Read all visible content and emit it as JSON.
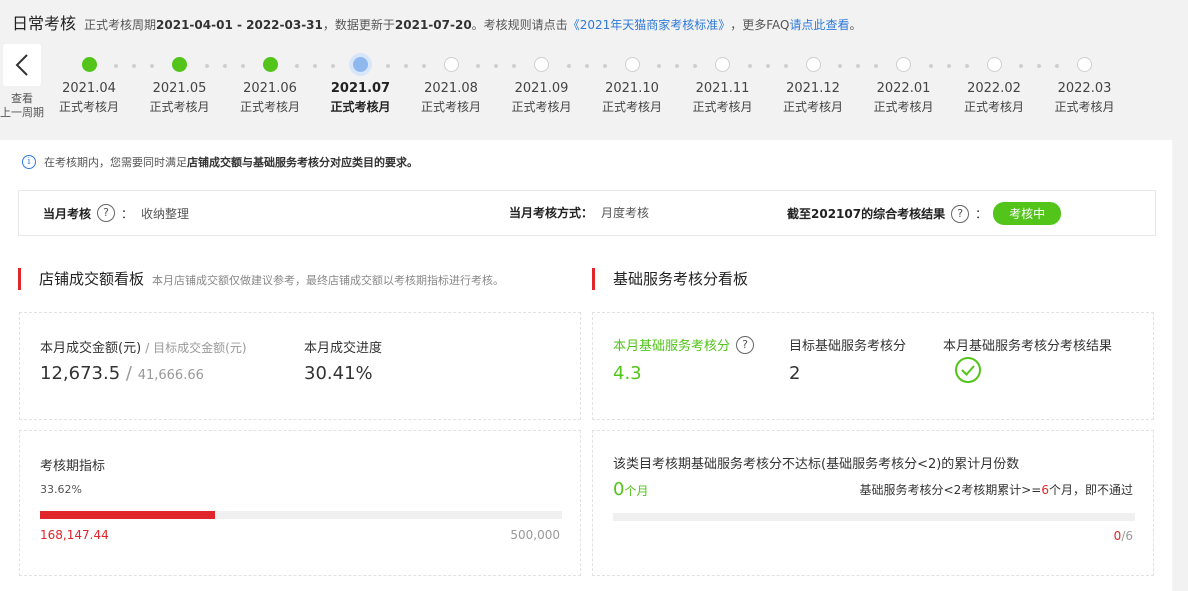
{
  "header": {
    "title": "日常考核",
    "period_prefix": "正式考核周期",
    "period": "2021-04-01 - 2022-03-31",
    "update_prefix": "，数据更新于",
    "update_date": "2021-07-20",
    "rule_prefix": "。考核规则请点击",
    "rule_link": "《2021年天猫商家考核标准》",
    "faq_prefix": "，更多FAQ",
    "faq_link": "请点此查看",
    "faq_suffix": "。"
  },
  "back": {
    "label_line1": "查看",
    "label_line2": "上一周期"
  },
  "timeline": [
    {
      "month": "2021.04",
      "label": "正式考核月",
      "status": "done"
    },
    {
      "month": "2021.05",
      "label": "正式考核月",
      "status": "done"
    },
    {
      "month": "2021.06",
      "label": "正式考核月",
      "status": "done"
    },
    {
      "month": "2021.07",
      "label": "正式考核月",
      "status": "current"
    },
    {
      "month": "2021.08",
      "label": "正式考核月",
      "status": "future"
    },
    {
      "month": "2021.09",
      "label": "正式考核月",
      "status": "future"
    },
    {
      "month": "2021.10",
      "label": "正式考核月",
      "status": "future"
    },
    {
      "month": "2021.11",
      "label": "正式考核月",
      "status": "future"
    },
    {
      "month": "2021.12",
      "label": "正式考核月",
      "status": "future"
    },
    {
      "month": "2022.01",
      "label": "正式考核月",
      "status": "future"
    },
    {
      "month": "2022.02",
      "label": "正式考核月",
      "status": "future"
    },
    {
      "month": "2022.03",
      "label": "正式考核月",
      "status": "future"
    }
  ],
  "notice": {
    "pre": "在考核期内，您需要同时满足",
    "bold": "店铺成交额与基础服务考核分对应类目的要求。"
  },
  "summary": {
    "monthly_label": "当月考核",
    "colon": "：",
    "monthly_value": "收纳整理",
    "method_label": "当月考核方式：",
    "method_value": "月度考核",
    "result_label": "截至202107的综合考核结果",
    "result_badge": "考核中",
    "help": "?"
  },
  "sales": {
    "title": "店铺成交额看板",
    "subtitle": "本月店铺成交额仅做建议参考，最终店铺成交额以考核期指标进行考核。",
    "amount_label": "本月成交金额(元)",
    "target_label": "/ 目标成交金额(元)",
    "amount_value": "12,673.5",
    "slash": "/",
    "target_value": "41,666.66",
    "progress_label": "本月成交进度",
    "progress_value": "30.41%",
    "period_label": "考核期指标",
    "period_percent": "33.62%",
    "period_fraction": 0.3362,
    "period_current": "168,147.44",
    "period_target": "500,000"
  },
  "service": {
    "title": "基础服务考核分看板",
    "score_label": "本月基础服务考核分",
    "score_value": "4.3",
    "target_label": "目标基础服务考核分",
    "target_value": "2",
    "result_label": "本月基础服务考核分考核结果",
    "fail_label": "该类目考核期基础服务考核分不达标(基础服务考核分<2)的累计月份数",
    "fail_count": "0",
    "fail_unit": "个月",
    "rule_pre": "基础服务考核分<2考核期累计>=",
    "rule_num": "6",
    "rule_post": "个月，即不通过",
    "fail_progress_num": "0",
    "fail_progress_den": "/6",
    "fail_fraction": 0
  },
  "colors": {
    "green": "#52c41a",
    "red": "#e0252b",
    "blue": "#2f7ad8"
  }
}
